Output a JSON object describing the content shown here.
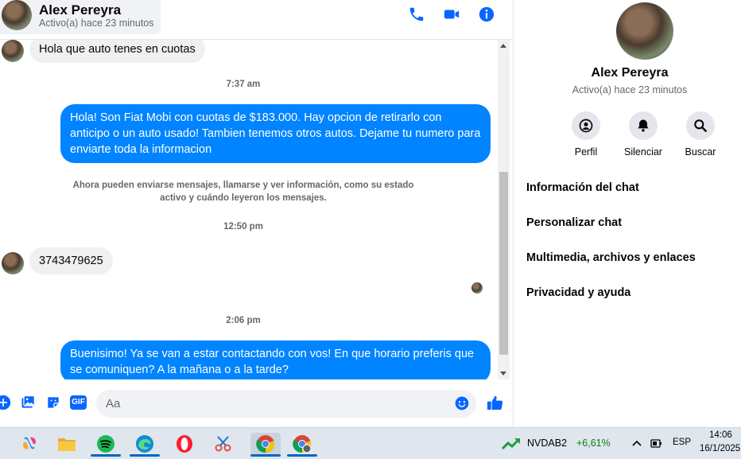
{
  "header": {
    "name": "Alex Pereyra",
    "status": "Activo(a) hace 23 minutos"
  },
  "messages": [
    {
      "direction": "in",
      "text": "Hola que auto tenes en cuotas"
    },
    {
      "timestamp": "7:37 am"
    },
    {
      "direction": "out",
      "text": "Hola! Son Fiat Mobi con cuotas de $183.000. Hay opcion de retirarlo con anticipo o un auto usado! Tambien tenemos otros autos. Dejame tu numero para enviarte toda la informacion"
    },
    {
      "system": "Ahora pueden enviarse mensajes, llamarse y ver información, como su estado activo y cuándo leyeron los mensajes."
    },
    {
      "timestamp": "12:50 pm"
    },
    {
      "direction": "in",
      "text": "3743479625"
    },
    {
      "timestamp": "2:06 pm"
    },
    {
      "direction": "out",
      "text": "Buenisimo! Ya se van a estar contactando con vos! En que horario preferis que se comuniquen? A la mañana o a la tarde?"
    }
  ],
  "composer": {
    "placeholder": "Aa",
    "gif_label": "GIF"
  },
  "panel": {
    "name": "Alex Pereyra",
    "status": "Activo(a) hace 23 minutos",
    "actions": [
      {
        "label": "Perfil",
        "icon": "profile-icon"
      },
      {
        "label": "Silenciar",
        "icon": "bell-icon"
      },
      {
        "label": "Buscar",
        "icon": "search-icon"
      }
    ],
    "menu": [
      "Información del chat",
      "Personalizar chat",
      "Multimedia, archivos y enlaces",
      "Privacidad y ayuda"
    ]
  },
  "taskbar": {
    "stock_symbol": "NVDAB2",
    "stock_change": "+6,61%",
    "language": "ESP",
    "time": "14:06",
    "date": "16/1/2025"
  },
  "colors": {
    "messenger_blue": "#0084ff",
    "accent_blue": "#0866ff",
    "incoming_bubble": "#f0f0f0",
    "stock_green": "#0f7b0f"
  }
}
